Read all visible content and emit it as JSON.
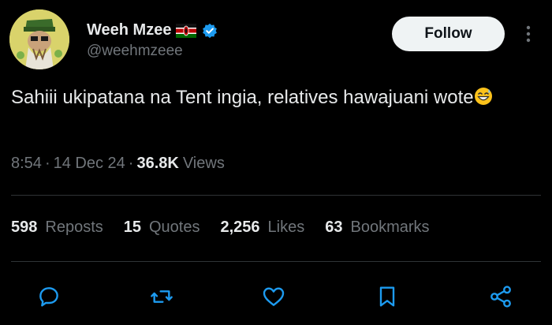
{
  "author": {
    "display_name": "Weeh Mzee",
    "handle": "@weehmzeee",
    "verified": true,
    "flag": "kenya-flag-icon"
  },
  "follow_label": "Follow",
  "tweet": {
    "text": "Sahiii ukipatana na Tent ingia, relatives hawajuani wote",
    "emoji": "grinning-sweat-emoji-icon"
  },
  "meta": {
    "time": "8:54",
    "date": "14 Dec 24",
    "views_count": "36.8K",
    "views_label": "Views",
    "separator": "·"
  },
  "stats": [
    {
      "count": "598",
      "label": "Reposts"
    },
    {
      "count": "15",
      "label": "Quotes"
    },
    {
      "count": "2,256",
      "label": "Likes"
    },
    {
      "count": "63",
      "label": "Bookmarks"
    }
  ],
  "actions": [
    "reply-icon",
    "repost-icon",
    "like-icon",
    "bookmark-icon",
    "share-icon"
  ],
  "colors": {
    "background": "#000000",
    "text": "#e7e9ea",
    "muted": "#71767b",
    "divider": "#2f3336",
    "follow_bg": "#eff3f4",
    "verified": "#1d9bf0"
  }
}
